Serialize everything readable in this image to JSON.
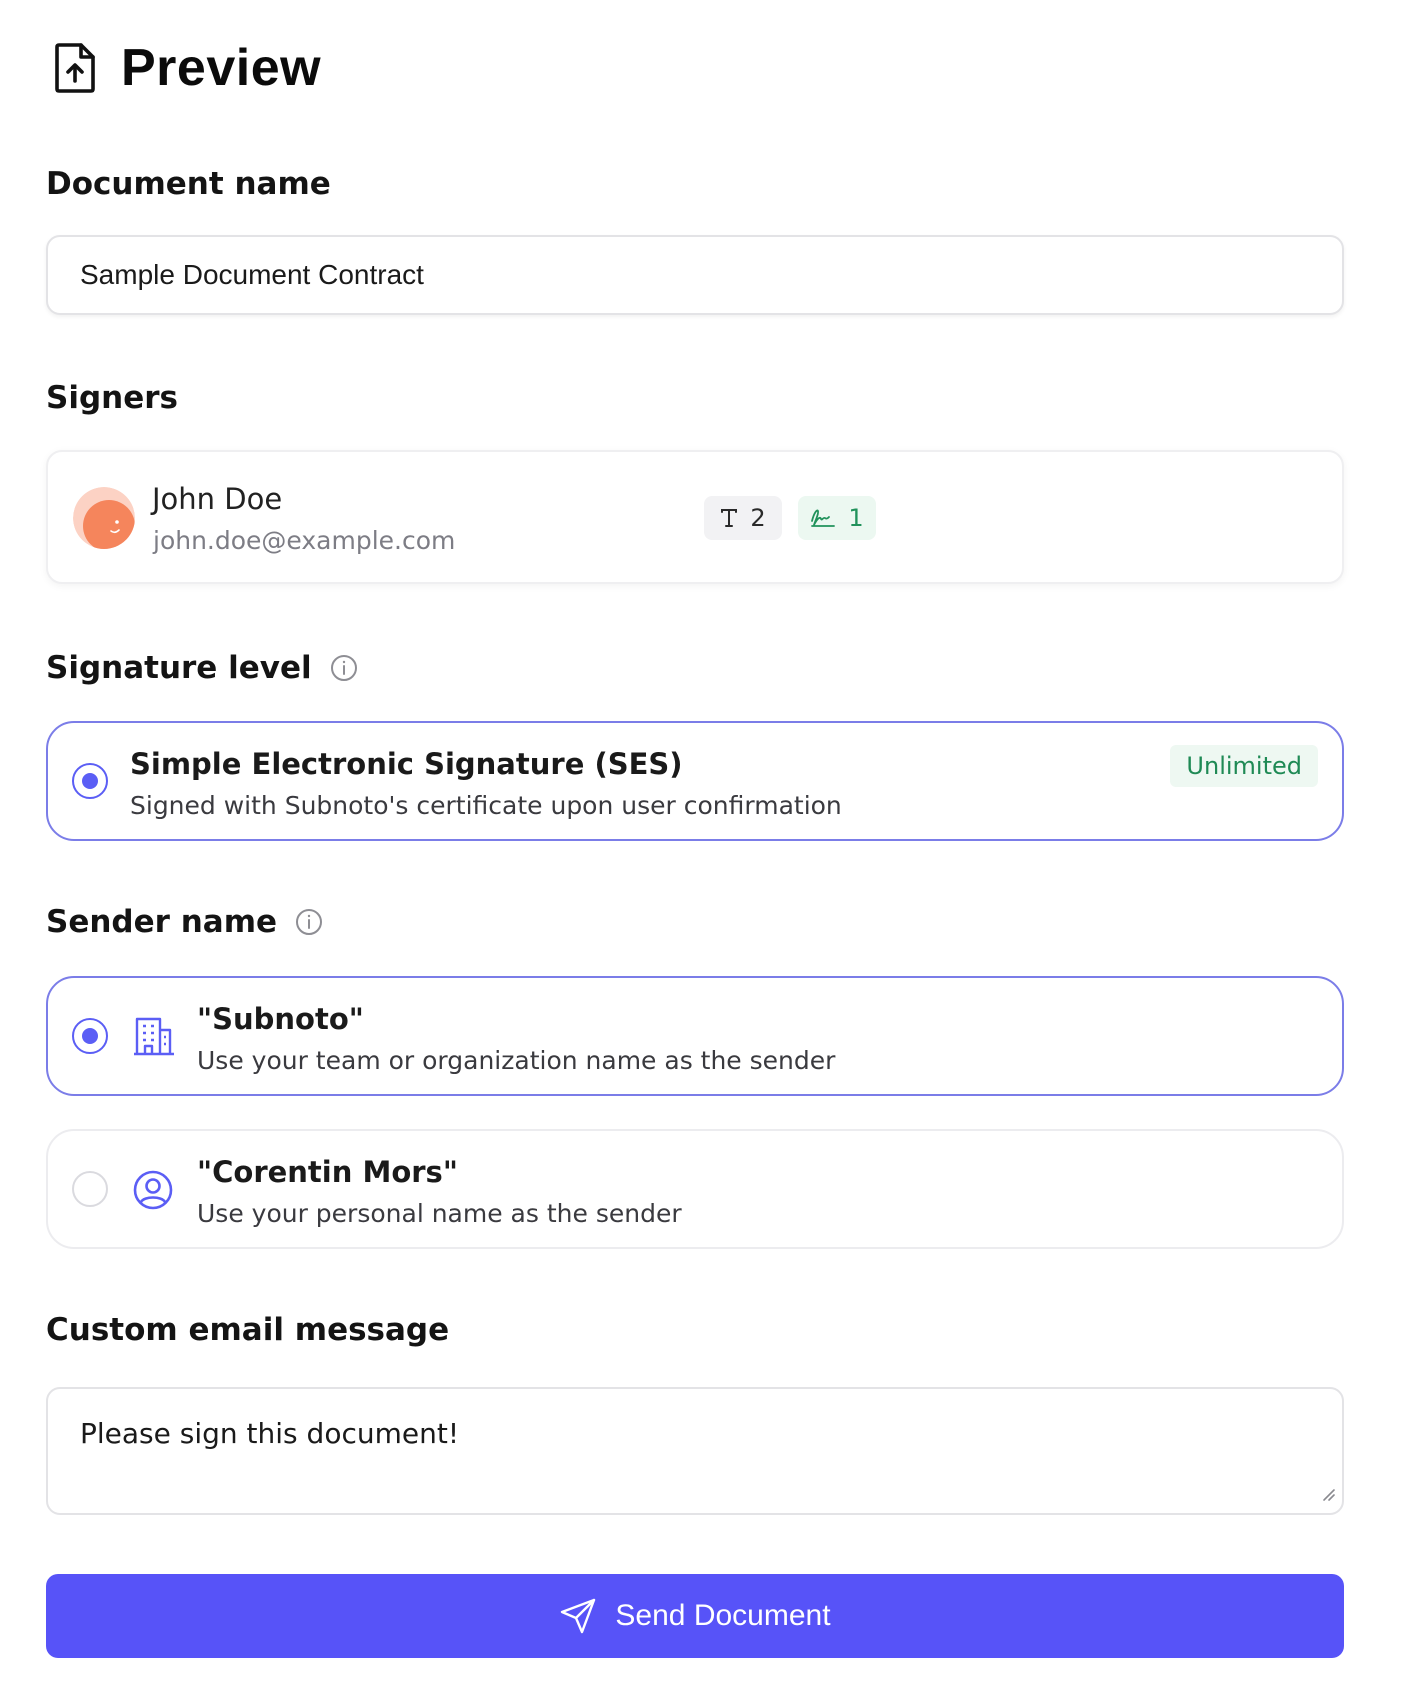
{
  "header": {
    "title": "Preview",
    "icon": "file-upload-icon"
  },
  "document_name": {
    "label": "Document name",
    "value": "Sample Document Contract"
  },
  "signers": {
    "label": "Signers",
    "items": [
      {
        "name": "John Doe",
        "email": "john.doe@example.com",
        "text_fields": "2",
        "signature_fields": "1"
      }
    ]
  },
  "signature_level": {
    "label": "Signature level",
    "options": [
      {
        "title": "Simple Electronic Signature (SES)",
        "description": "Signed with Subnoto's certificate upon user confirmation",
        "tag": "Unlimited",
        "selected": true
      }
    ]
  },
  "sender_name": {
    "label": "Sender name",
    "options": [
      {
        "title": "\"Subnoto\"",
        "description": "Use your team or organization name as the sender",
        "icon": "building-icon",
        "selected": true
      },
      {
        "title": "\"Corentin Mors\"",
        "description": "Use your personal name as the sender",
        "icon": "user-circle-icon",
        "selected": false
      }
    ]
  },
  "custom_message": {
    "label": "Custom email message",
    "value": "Please sign this document!"
  },
  "send_button": {
    "label": "Send Document"
  },
  "colors": {
    "accent": "#5753f8",
    "success": "#1f8a55",
    "selected_border": "#7b7de8"
  }
}
